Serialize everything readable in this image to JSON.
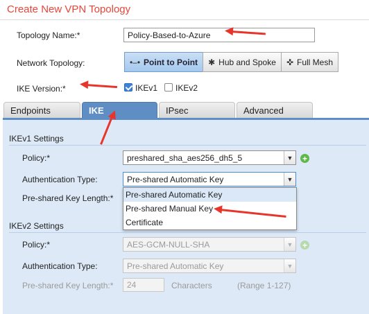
{
  "window": {
    "title": "Create New VPN Topology"
  },
  "form": {
    "topology_name_label": "Topology Name:*",
    "topology_name_value": "Policy-Based-to-Azure",
    "network_topology_label": "Network Topology:",
    "topology_options": [
      {
        "label": "Point to Point",
        "icon": "point-to-point-icon",
        "glyph": "•–•",
        "selected": true
      },
      {
        "label": "Hub and Spoke",
        "icon": "hub-and-spoke-icon",
        "glyph": "✱",
        "selected": false
      },
      {
        "label": "Full Mesh",
        "icon": "full-mesh-icon",
        "glyph": "✜",
        "selected": false
      }
    ],
    "ike_version_label": "IKE Version:*",
    "ikev1": {
      "label": "IKEv1",
      "checked": true
    },
    "ikev2": {
      "label": "IKEv2",
      "checked": false
    }
  },
  "tabs": [
    {
      "label": "Endpoints",
      "active": false
    },
    {
      "label": "IKE",
      "active": true
    },
    {
      "label": "IPsec",
      "active": false
    },
    {
      "label": "Advanced",
      "active": false
    }
  ],
  "ikev1_settings": {
    "heading": "IKEv1 Settings",
    "policy_label": "Policy:*",
    "policy_value": "preshared_sha_aes256_dh5_5",
    "auth_type_label": "Authentication Type:",
    "auth_type_value": "Pre-shared Automatic Key",
    "key_length_label": "Pre-shared Key Length:*",
    "auth_type_options": [
      {
        "label": "Pre-shared Automatic Key",
        "highlighted": true
      },
      {
        "label": "Pre-shared Manual Key",
        "highlighted": false
      },
      {
        "label": "Certificate",
        "highlighted": false
      }
    ]
  },
  "ikev2_settings": {
    "heading": "IKEv2 Settings",
    "policy_label": "Policy:*",
    "policy_value": "AES-GCM-NULL-SHA",
    "auth_type_label": "Authentication Type:",
    "auth_type_value": "Pre-shared Automatic Key",
    "key_length_label": "Pre-shared Key Length:*",
    "key_length_value": "24",
    "key_length_unit": "Characters",
    "key_length_range": "(Range 1-127)"
  },
  "icons": {
    "chevron": "▼",
    "plus": "+"
  },
  "colors": {
    "title": "#e8463a",
    "active_tab": "#5f8ec4",
    "panel_bg": "#dde9f7",
    "annotation_arrow": "#e8352b",
    "add_button": "#5fb84a"
  }
}
